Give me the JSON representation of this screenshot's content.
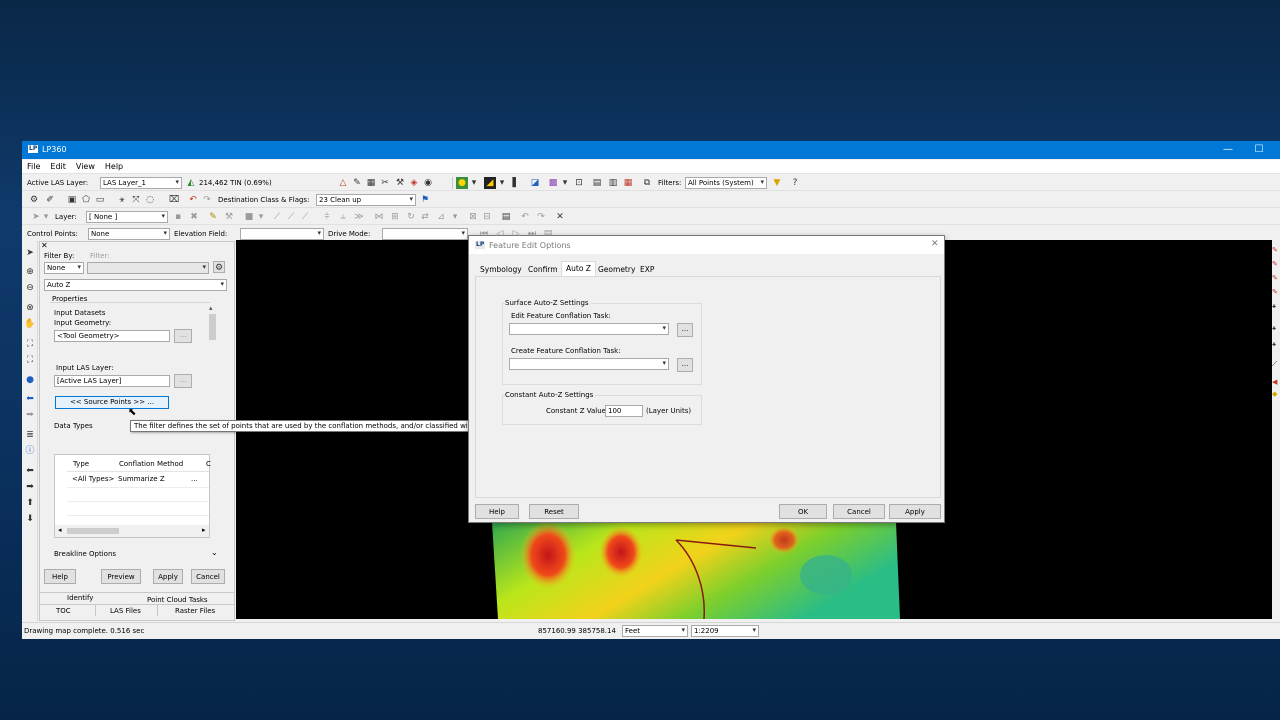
{
  "window": {
    "badge": "LP",
    "title": "LP360",
    "minimize": "—",
    "maximize": "☐"
  },
  "menu": [
    "File",
    "Edit",
    "View",
    "Help"
  ],
  "toolbar1": {
    "active_las_label": "Active LAS Layer:",
    "active_las_value": "LAS Layer_1",
    "tin_info": "214,462 TIN (0.69%)",
    "filters_label": "Filters:",
    "filters_value": "All Points (System)"
  },
  "toolbar2": {
    "dest_label": "Destination Class & Flags:",
    "dest_value": "23  Clean up"
  },
  "toolbar3": {
    "layer_label": "Layer:",
    "layer_value": "[ None ]"
  },
  "toolbar4": {
    "control_points_label": "Control Points:",
    "control_points_value": "None",
    "elevation_field_label": "Elevation Field:",
    "elevation_field_value": "",
    "drive_mode_label": "Drive Mode:",
    "drive_mode_value": ""
  },
  "panel": {
    "filter_by_label": "Filter By:",
    "filter_label": "Filter:",
    "filter_by_value": "None",
    "task_value": "Auto Z",
    "properties_label": "Properties",
    "input_datasets_label": "Input Datasets",
    "input_geometry_label": "Input Geometry:",
    "input_geometry_value": "<Tool Geometry>",
    "input_las_label": "Input LAS Layer:",
    "input_las_value": "[Active LAS Layer]",
    "browse": "...",
    "source_points": "<< Source Points >> ...",
    "data_types_label": "Data Types",
    "table_headers": [
      "Type",
      "Conflation Method",
      "C"
    ],
    "table_rows": [
      [
        "<All Types>",
        "Summarize Z",
        "..."
      ]
    ],
    "breakline_label": "Breakline Options",
    "buttons": {
      "help": "Help",
      "preview": "Preview",
      "apply": "Apply",
      "cancel": "Cancel"
    },
    "tabs_top": [
      "Identify",
      "Point Cloud Tasks"
    ],
    "tabs_bottom": [
      "TOC",
      "LAS Files",
      "Raster Files"
    ]
  },
  "tooltip": "The filter defines the set of points that are used by the conflation methods, and/or classified within the specified buffers of the features.",
  "dialog": {
    "badge": "LP",
    "title": "Feature Edit Options",
    "close": "✕",
    "tabs": [
      "Symbology",
      "Confirm",
      "Auto Z",
      "Geometry",
      "EXP"
    ],
    "active_tab": "Auto Z",
    "surface_group": "Surface Auto-Z Settings",
    "edit_task_label": "Edit Feature Conflation Task:",
    "edit_task_value": "",
    "create_task_label": "Create Feature Conflation Task:",
    "create_task_value": "",
    "browse": "...",
    "constant_group": "Constant Auto-Z Settings",
    "constant_z_label": "Constant Z Value",
    "constant_z_value": "100",
    "layer_units": "(Layer Units)",
    "buttons": {
      "help": "Help",
      "reset": "Reset",
      "ok": "OK",
      "cancel": "Cancel",
      "apply": "Apply"
    }
  },
  "status": {
    "message": "Drawing map complete.  0.516 sec",
    "coords": "857160.99 385758.14",
    "units": "Feet",
    "scale": "1:2209"
  },
  "icons": {
    "select": "arrow-pointer-icon",
    "zoom_in": "zoom-in-icon",
    "zoom_out": "zoom-out-icon",
    "pan": "hand-icon",
    "globe": "globe-icon",
    "info": "info-icon",
    "filter": "funnel-icon",
    "help_cursor": "help-cursor-icon"
  },
  "colors": {
    "titlebar": "#0078d7",
    "accent": "#0078d7",
    "tooltip_border": "#767676",
    "map_background": "#000000"
  }
}
